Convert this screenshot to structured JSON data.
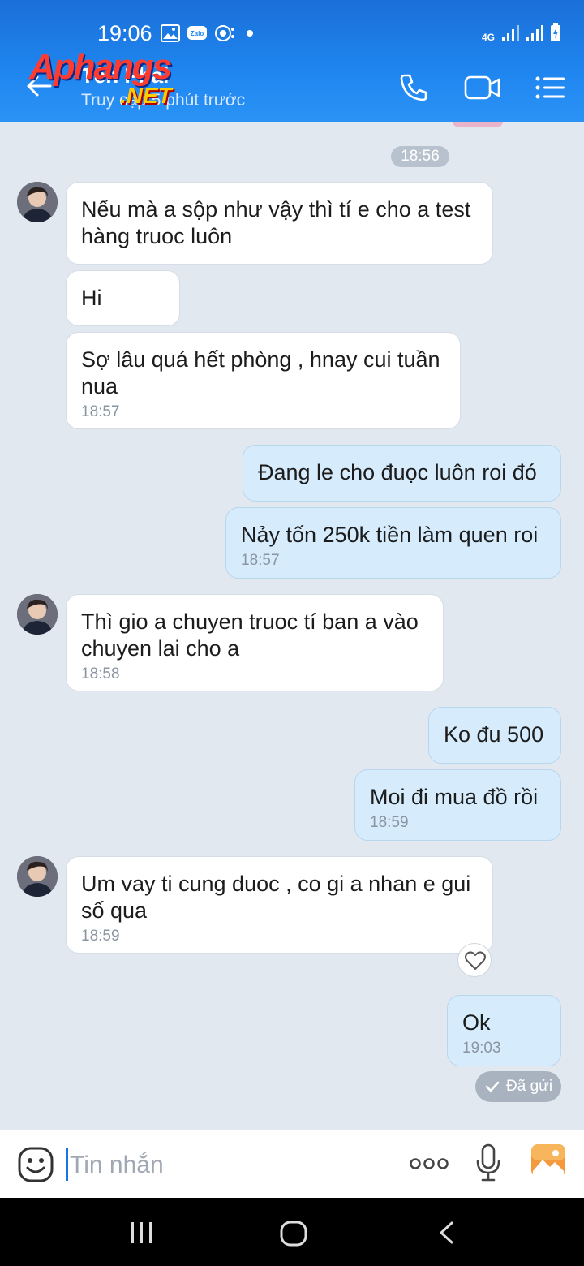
{
  "status_bar": {
    "time": "19:06",
    "network": "4G"
  },
  "header": {
    "contact_name": "Tên Phải",
    "subtitle": "Truy cập 5 phút trước",
    "watermark_main": "Aphangs",
    "watermark_sub": ".NET"
  },
  "divider_time": "18:56",
  "messages": [
    {
      "side": "in",
      "text": "Nếu mà a sộp như vậy thì tí e cho a test hàng truoc luôn",
      "time": ""
    },
    {
      "side": "in",
      "text": "Hi",
      "time": ""
    },
    {
      "side": "in",
      "text": "Sợ lâu quá hết phòng , hnay cui tuần nua",
      "time": "18:57"
    },
    {
      "side": "out",
      "text": "Đang le cho đuọc luôn roi đó",
      "time": ""
    },
    {
      "side": "out",
      "text": "Nảy tốn 250k tiền làm quen roi",
      "time": "18:57"
    },
    {
      "side": "in",
      "text": "Thì gio a chuyen truoc tí ban a vào chuyen lai cho a",
      "time": "18:58"
    },
    {
      "side": "out",
      "text": "Ko đu 500",
      "time": ""
    },
    {
      "side": "out",
      "text": "Moi đi mua đồ rồi",
      "time": "18:59"
    },
    {
      "side": "in",
      "text": "Um vay ti cung duoc , co gi a nhan e gui số qua",
      "time": "18:59"
    },
    {
      "side": "out",
      "text": "Ok",
      "time": "19:03"
    }
  ],
  "sent_status": "Đã gửi",
  "input": {
    "placeholder": "Tin nhắn"
  },
  "colors": {
    "header": "#1f86f0",
    "incoming_bubble": "#ffffff",
    "outgoing_bubble": "#d6ecfc",
    "chat_bg": "#e2e8f0"
  }
}
